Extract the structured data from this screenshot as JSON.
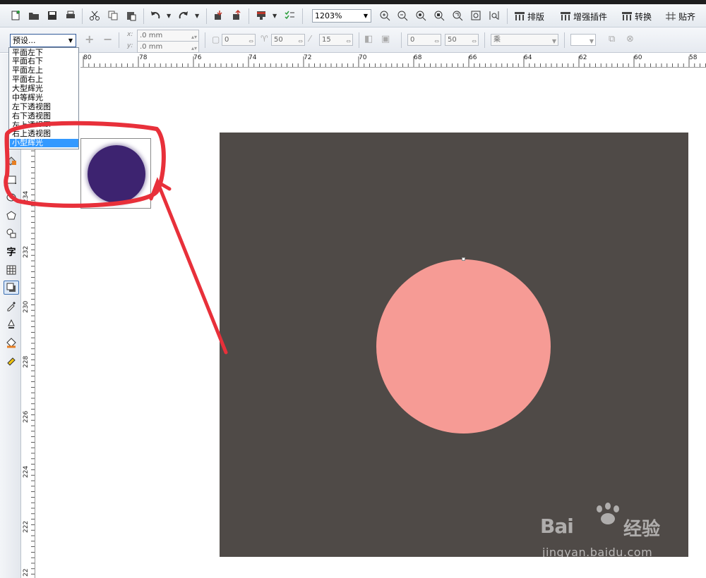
{
  "toolbar": {
    "zoom_value": "1203%",
    "layout_label": "排版",
    "enhance_plugin_label": "增强插件",
    "convert_label": "转换",
    "snap_label": "贴齐"
  },
  "property_bar": {
    "preset_value": "预设...",
    "x_label": "x:",
    "y_label": "y:",
    "x_value": ".0 mm",
    "y_value": ".0 mm",
    "offset_value": "0",
    "opacity_value": "50",
    "feather_value": "15",
    "stretch_value": "0",
    "fade_value": "50",
    "blend_mode": "乘"
  },
  "preset_dropdown": {
    "items": [
      "平面左下",
      "平面右下",
      "平面左上",
      "平面右上",
      "大型辉光",
      "中等辉光",
      "左下透视图",
      "右下透视图",
      "左上透视图",
      "右上透视图",
      "小型辉光"
    ],
    "selected": "小型辉光"
  },
  "ruler": {
    "h_labels": [
      "80",
      "78",
      "76",
      "74",
      "72",
      "70",
      "68",
      "66",
      "64",
      "62",
      "60",
      "58"
    ],
    "v_labels": [
      "234",
      "232",
      "230",
      "228",
      "226",
      "224",
      "222",
      "22"
    ]
  },
  "toolbox": {
    "text_tool_glyph": "字"
  },
  "colors": {
    "artboard": "#4f4a47",
    "circle": "#f69b95",
    "preview_circle": "#3d2370",
    "annotation": "#e8303a",
    "selected_item": "#3399ff"
  },
  "watermark": {
    "brand": "Bai",
    "brand_cn": "经验",
    "url": "jingyan.baidu.com"
  }
}
